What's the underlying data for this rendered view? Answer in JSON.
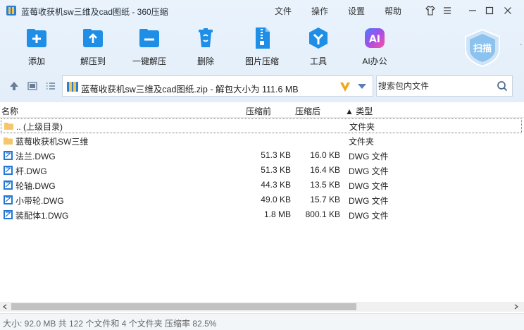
{
  "window": {
    "title": "蓝莓收获机sw三维及cad图纸 - 360压缩",
    "menu": [
      "文件",
      "操作",
      "设置",
      "帮助"
    ]
  },
  "toolbar": [
    {
      "label": "添加",
      "icon": "add-icon"
    },
    {
      "label": "解压到",
      "icon": "extract-to-icon"
    },
    {
      "label": "一键解压",
      "icon": "one-click-extract-icon"
    },
    {
      "label": "删除",
      "icon": "delete-icon"
    },
    {
      "label": "图片压缩",
      "icon": "image-compress-icon"
    },
    {
      "label": "工具",
      "icon": "tools-icon"
    },
    {
      "label": "AI办公",
      "icon": "ai-office-icon"
    }
  ],
  "scan": {
    "label": "扫描"
  },
  "address": {
    "path": "蓝莓收获机sw三维及cad图纸.zip - 解包大小为 111.6 MB"
  },
  "search": {
    "placeholder": "搜索包内文件"
  },
  "columns": {
    "name": "名称",
    "size": "压缩前",
    "packed": "压缩后",
    "type": "▲ 类型"
  },
  "files": [
    {
      "name": ".. (上级目录)",
      "size": "",
      "packed": "",
      "type": "文件夹",
      "kind": "folder"
    },
    {
      "name": "蓝莓收获机SW三维",
      "size": "",
      "packed": "",
      "type": "文件夹",
      "kind": "folder"
    },
    {
      "name": "法兰.DWG",
      "size": "51.3 KB",
      "packed": "16.0 KB",
      "type": "DWG 文件",
      "kind": "dwg"
    },
    {
      "name": "杆.DWG",
      "size": "51.3 KB",
      "packed": "16.4 KB",
      "type": "DWG 文件",
      "kind": "dwg"
    },
    {
      "name": "轮轴.DWG",
      "size": "44.3 KB",
      "packed": "13.5 KB",
      "type": "DWG 文件",
      "kind": "dwg"
    },
    {
      "name": "小带轮.DWG",
      "size": "49.0 KB",
      "packed": "15.7 KB",
      "type": "DWG 文件",
      "kind": "dwg"
    },
    {
      "name": "装配体1.DWG",
      "size": "1.8 MB",
      "packed": "800.1 KB",
      "type": "DWG 文件",
      "kind": "dwg"
    }
  ],
  "status": {
    "text": "大小: 92.0 MB 共 122 个文件和 4 个文件夹 压缩率 82.5%"
  },
  "colors": {
    "accent": "#1a8fe0",
    "folder": "#f5c66a",
    "dwg": "#2277d6"
  }
}
